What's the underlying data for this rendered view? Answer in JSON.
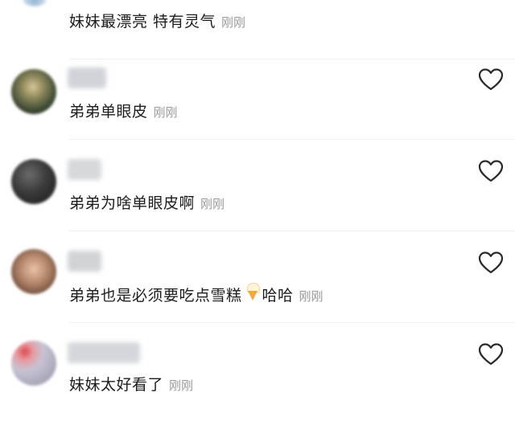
{
  "comments": [
    {
      "text": "妹妹最漂亮 特有灵气",
      "time": "刚刚",
      "has_emoji": false,
      "liked": false
    },
    {
      "text": "弟弟单眼皮",
      "time": "刚刚",
      "has_emoji": false,
      "liked": false
    },
    {
      "text": "弟弟为啥单眼皮啊",
      "time": "刚刚",
      "has_emoji": false,
      "liked": false
    },
    {
      "text": "弟弟也是必须要吃点雪糕",
      "emoji": "ice-cream",
      "text_after_emoji": "哈哈",
      "time": "刚刚",
      "liked": false
    },
    {
      "text": "妹妹太好看了",
      "time": "刚刚",
      "has_emoji": false,
      "liked": false
    }
  ],
  "colors": {
    "background": "#ffffff",
    "text": "#1c1c1c",
    "timestamp": "#9a9a9a",
    "heart_outline": "#2a2a2a",
    "divider": "#f0f0f2"
  },
  "icons": {
    "like": "heart-outline-icon",
    "emoji": "ice-cream-emoji"
  }
}
